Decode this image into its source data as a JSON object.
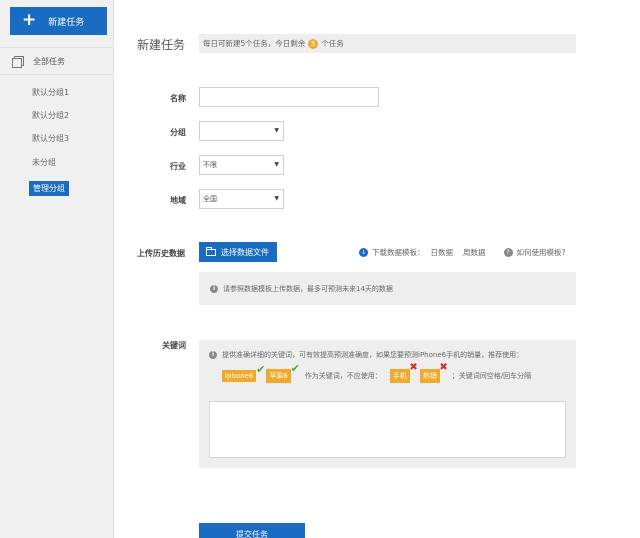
{
  "sidebar": {
    "new_task": "新建任务",
    "all_tasks": "全部任务",
    "groups": [
      "默认分组1",
      "默认分组2",
      "默认分组3",
      "未分组"
    ],
    "manage": "管理分组"
  },
  "header": {
    "title": "新建任务",
    "info_prefix": "每日可新建5个任务，今日剩余",
    "info_count": "5",
    "info_suffix": "个任务"
  },
  "form": {
    "name_label": "名称",
    "name_value": "",
    "group_label": "分组",
    "group_value": "",
    "industry_label": "行业",
    "industry_value": "不限",
    "region_label": "地域",
    "region_value": "全国"
  },
  "upload": {
    "label": "上传历史数据",
    "button": "选择数据文件",
    "download_label": "下载数据模板：",
    "daily": "日数据",
    "weekly": "周数据",
    "howto": "如何使用模板?",
    "hint": "请参照数据模板上传数据，最多可预测未来14天的数据"
  },
  "keywords": {
    "label": "关键词",
    "hint": "提供准确详细的关键词，可有效提高预测准确度，如果您要预测iPhone6手机的销量，推荐使用：",
    "good_tags": [
      "iphone6",
      "苹果6"
    ],
    "mid_text": "作为关键词，不应使用：",
    "bad_tags": [
      "手机",
      "热销"
    ],
    "tail_text": "；关键词间空格/回车分隔",
    "value": ""
  },
  "submit": "提交任务",
  "colors": {
    "accent": "#1a6cc2",
    "tag": "#f0a92a",
    "ok": "#4ea52f",
    "bad": "#d62b2b"
  }
}
